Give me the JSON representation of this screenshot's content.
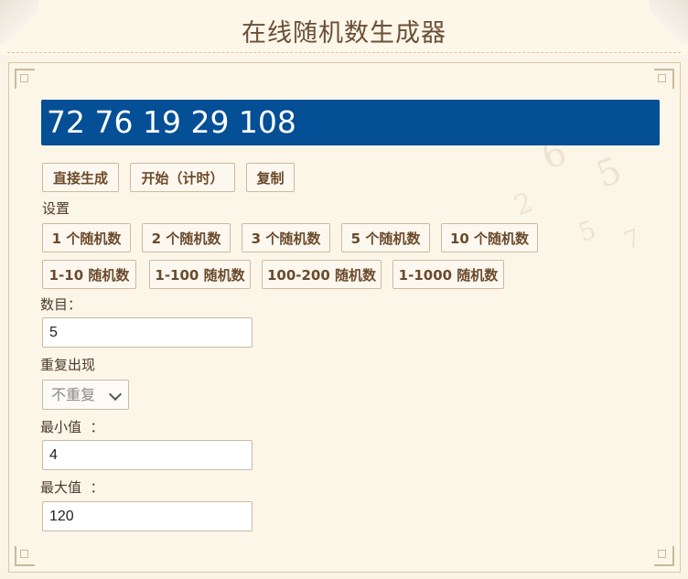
{
  "header": {
    "title": "在线随机数生成器"
  },
  "result": {
    "value": "72 76 19 29 108"
  },
  "actions": {
    "generate": "直接生成",
    "start_timed": "开始（计时）",
    "copy": "复制"
  },
  "settings_label": "设置",
  "presets_count": [
    "1 个随机数",
    "2 个随机数",
    "3 个随机数",
    "5 个随机数",
    "10 个随机数"
  ],
  "presets_range": [
    "1-10 随机数",
    "1-100 随机数",
    "100-200 随机数",
    "1-1000 随机数"
  ],
  "form": {
    "count_label": "数目：",
    "count_value": "5",
    "repeat_label": "重复出现",
    "repeat_selected": "不重复",
    "min_label": "最小值  ：",
    "min_value": "4",
    "max_label": "最大值  ：",
    "max_value": "120"
  },
  "colors": {
    "result_bg": "#044f96",
    "button_text": "#6b4a2c",
    "panel_bg": "#fcf6e9"
  }
}
